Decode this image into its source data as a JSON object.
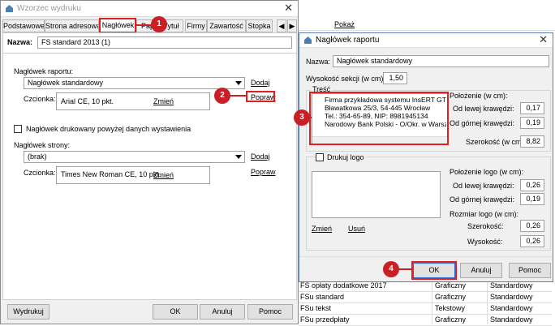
{
  "background": {
    "top_link": "Pokaż",
    "rows": [
      {
        "name": "FS opłaty dodatkowe 2017",
        "type": "Graficzny",
        "kind": "Standardowy"
      },
      {
        "name": "FSu standard",
        "type": "Graficzny",
        "kind": "Standardowy"
      },
      {
        "name": "FSu tekst",
        "type": "Tekstowy",
        "kind": "Standardowy"
      },
      {
        "name": "FSu przedpłaty",
        "type": "Graficzny",
        "kind": "Standardowy"
      }
    ]
  },
  "left_dialog": {
    "title": "Wzorzec wydruku",
    "tabs": [
      "Podstawowe",
      "Strona adresowa",
      "Nagłówek",
      "Pap",
      "Tytuł",
      "Firmy",
      "Zawartość",
      "Stopka"
    ],
    "name_label": "Nazwa:",
    "name_value": "FS standard 2013 (1)",
    "report_header_label": "Nagłówek raportu:",
    "report_header_value": "Nagłówek standardowy",
    "add_link": "Dodaj",
    "font_label": "Czcionka:",
    "font_value": "Arial CE, 10 pkt.",
    "change_link": "Zmień",
    "edit_link": "Popraw",
    "printed_above_label": "Nagłówek drukowany powyżej danych wystawienia",
    "page_header_label": "Nagłówek strony:",
    "page_header_value": "(brak)",
    "add_link2": "Dodaj",
    "font_label2": "Czcionka:",
    "font_value2": "Times New Roman CE, 10 pkt.",
    "change_link2": "Zmień",
    "edit_link2": "Popraw",
    "btn_print": "Wydrukuj",
    "btn_ok": "OK",
    "btn_cancel": "Anuluj",
    "btn_help": "Pomoc"
  },
  "right_dialog": {
    "title": "Nagłówek raportu",
    "name_label": "Nazwa:",
    "name_value": "Nagłówek standardowy",
    "height_label": "Wysokość sekcji (w cm):",
    "height_value": "1,50",
    "content_group": "Treść",
    "content_lines": [
      "Firma przykładowa systemu InsERT GT",
      "Bławatkowa 25/3, 54-445 Wrocław",
      "Tel.: 354-65-89, NIP: 8981945134",
      "Narodowy Bank Polski  - O/Okr. w Warsz"
    ],
    "position_label": "Położenie (w cm):",
    "left_edge_label": "Od lewej krawędzi:",
    "left_edge_value": "0,17",
    "top_edge_label": "Od górnej krawędzi:",
    "top_edge_value": "0,19",
    "width_label": "Szerokość (w cm):",
    "width_value": "8,82",
    "print_logo_label": "Drukuj logo",
    "logo_position_label": "Położenie logo (w cm):",
    "logo_left_label": "Od lewej krawędzi:",
    "logo_left_value": "0,26",
    "logo_top_label": "Od górnej krawędzi:",
    "logo_top_value": "0,19",
    "logo_size_label": "Rozmiar logo (w cm):",
    "logo_width_label": "Szerokość:",
    "logo_width_value": "0,26",
    "logo_height_label": "Wysokość:",
    "logo_height_value": "0,26",
    "change_link": "Zmień",
    "delete_link": "Usuń",
    "btn_ok": "OK",
    "btn_cancel": "Anuluj",
    "btn_help": "Pomoc"
  },
  "badges": [
    "1",
    "2",
    "3",
    "4"
  ],
  "colors": {
    "annotation_red": "#c91f26",
    "highlight_red": "#e02020"
  }
}
